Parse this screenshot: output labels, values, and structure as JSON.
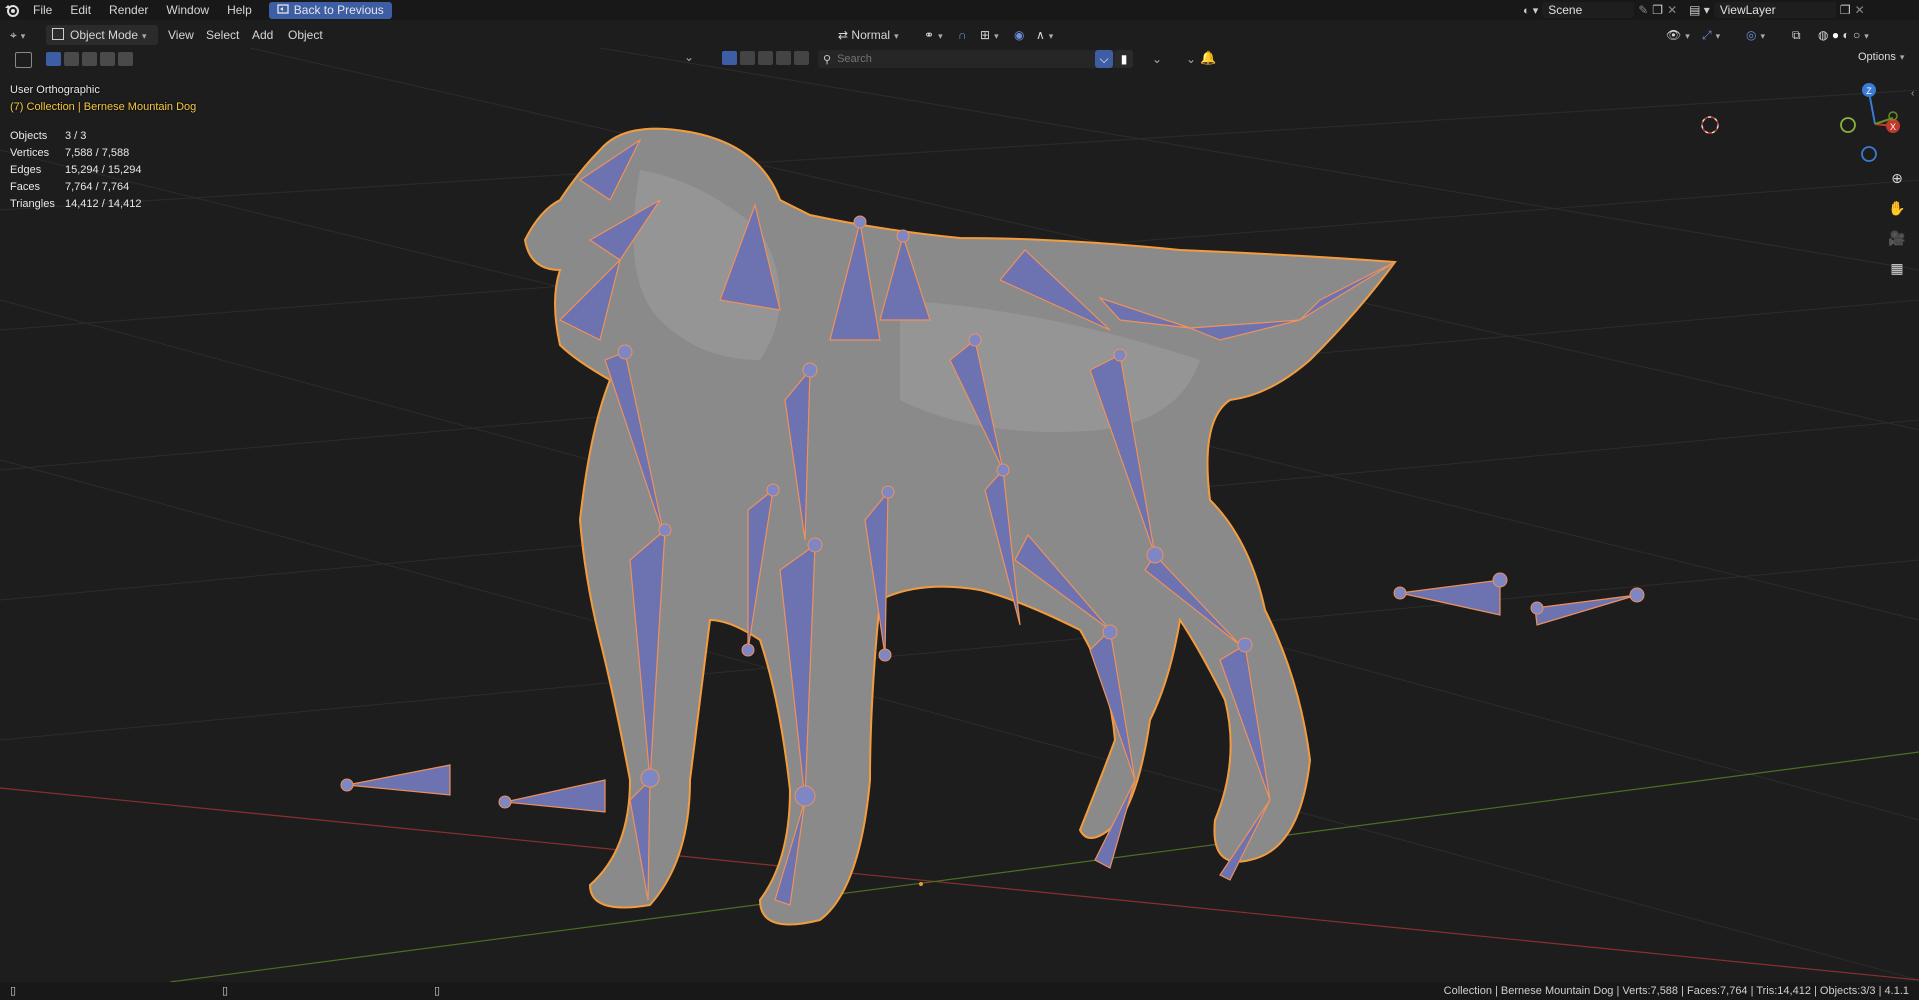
{
  "menu": {
    "items": [
      "File",
      "Edit",
      "Render",
      "Window",
      "Help"
    ],
    "back_button": "Back to Previous"
  },
  "topright": {
    "scene_label": "Scene",
    "viewlayer_label": "ViewLayer"
  },
  "header": {
    "mode": "Object Mode",
    "view": "View",
    "select": "Select",
    "add": "Add",
    "object": "Object",
    "orientation": "Normal",
    "options": "Options"
  },
  "search": {
    "placeholder": "Search"
  },
  "viewport": {
    "view_name": "User Orthographic",
    "collection_line": "(7) Collection | Bernese Mountain Dog",
    "stats": [
      {
        "label": "Objects",
        "value": "3 / 3"
      },
      {
        "label": "Vertices",
        "value": "7,588 / 7,588"
      },
      {
        "label": "Edges",
        "value": "15,294 / 15,294"
      },
      {
        "label": "Faces",
        "value": "7,764 / 7,764"
      },
      {
        "label": "Triangles",
        "value": "14,412 / 14,412"
      }
    ],
    "gizmo": {
      "z": "Z",
      "x": "X"
    }
  },
  "statusbar": {
    "text": "Collection | Bernese Mountain Dog | Verts:7,588 | Faces:7,764 | Tris:14,412 | Objects:3/3 | 4.1.1"
  },
  "colors": {
    "accent": "#3d5da5",
    "bone_fill": "#6c73b0",
    "bone_edge": "#f0915a",
    "selection_outline": "#f39c3e",
    "collection_text": "#f5c542",
    "axis_x": "#c0392b",
    "axis_y": "#6b8e23",
    "axis_z": "#3a7bd5"
  }
}
